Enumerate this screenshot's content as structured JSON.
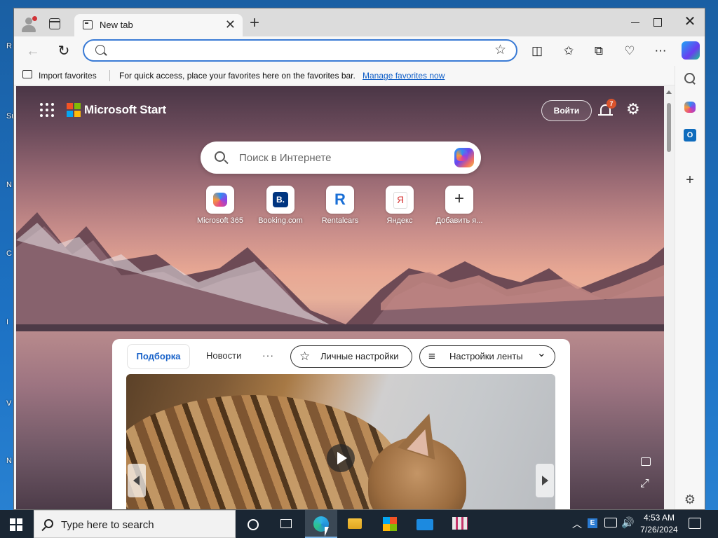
{
  "desktop": {
    "side_letters": [
      "R",
      "Su",
      "N",
      "C",
      "I",
      "V",
      "N"
    ]
  },
  "browser": {
    "tab": {
      "title": "New tab",
      "close_glyph": "✕"
    },
    "new_tab_glyph": "+",
    "window_controls": {
      "close_glyph": "✕"
    },
    "toolbar": {
      "back_glyph": "←",
      "refresh_glyph": "↻",
      "address_value": "",
      "address_placeholder": "",
      "favorite_glyph": "☆",
      "icons": [
        "split-screen-icon",
        "favorites-icon",
        "collections-icon",
        "browser-essentials-icon",
        "more-icon",
        "copilot-icon"
      ],
      "split_glyph": "◫",
      "favorites_glyph": "✩",
      "collections_glyph": "⧉",
      "essentials_glyph": "♡",
      "more_glyph": "⋯"
    },
    "favorites_bar": {
      "import_label": "Import favorites",
      "hint": "For quick access, place your favorites here on the favorites bar.",
      "manage_link": "Manage favorites now"
    }
  },
  "start_page": {
    "brand": "Microsoft Start",
    "signin_label": "Войти",
    "notification_count": "7",
    "settings_glyph": "⚙",
    "search_placeholder": "Поиск в Интернете",
    "quick_links": [
      {
        "label": "Microsoft 365"
      },
      {
        "label": "Booking.com"
      },
      {
        "label": "Rentalcars"
      },
      {
        "label": "Яндекс"
      },
      {
        "label": "Добавить я..."
      }
    ],
    "feed": {
      "tab_active": "Подборка",
      "tab_news": "Новости",
      "more": "···",
      "personal_settings": "Личные настройки",
      "feed_settings": "Настройки ленты"
    },
    "expand_glyph": "⤢"
  },
  "sidebar": {
    "add_glyph": "+",
    "settings_glyph": "⚙"
  },
  "taskbar": {
    "search_placeholder": "Type here to search",
    "tray": {
      "chevron": "︿",
      "volume_glyph": "🔊",
      "e_label": "E"
    },
    "clock": {
      "time": "4:53 AM",
      "date": "7/26/2024"
    }
  },
  "colors": {
    "accent": "#3a7bd5",
    "link": "#0f5ec7",
    "taskbar": "#1a2633",
    "notification_badge": "#d9532c"
  }
}
